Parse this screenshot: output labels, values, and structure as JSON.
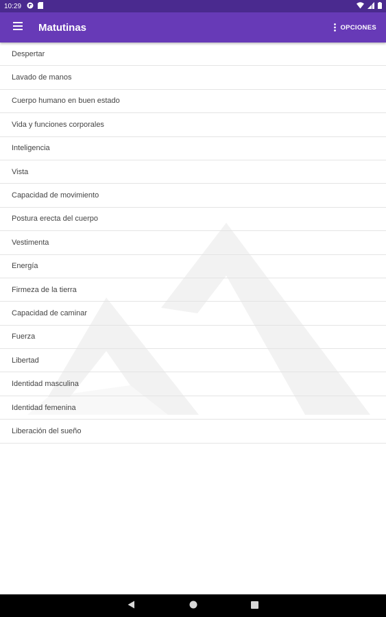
{
  "status_bar": {
    "time": "10:29"
  },
  "app_bar": {
    "title": "Matutinas",
    "options_label": "OPCIONES"
  },
  "items": [
    {
      "label": "Despertar"
    },
    {
      "label": "Lavado de manos"
    },
    {
      "label": "Cuerpo humano en buen estado"
    },
    {
      "label": "Vida y funciones corporales"
    },
    {
      "label": "Inteligencia"
    },
    {
      "label": "Vista"
    },
    {
      "label": "Capacidad de movimiento"
    },
    {
      "label": "Postura erecta del cuerpo"
    },
    {
      "label": "Vestimenta"
    },
    {
      "label": "Energía"
    },
    {
      "label": "Firmeza de la tierra"
    },
    {
      "label": "Capacidad de caminar"
    },
    {
      "label": "Fuerza"
    },
    {
      "label": "Libertad"
    },
    {
      "label": "Identidad masculina"
    },
    {
      "label": "Identidad femenina"
    },
    {
      "label": "Liberación del sueño"
    }
  ],
  "colors": {
    "app_bar": "#673ab7",
    "status_bar": "#4a2a8f",
    "text": "#444444",
    "divider": "#e4e4e4"
  }
}
